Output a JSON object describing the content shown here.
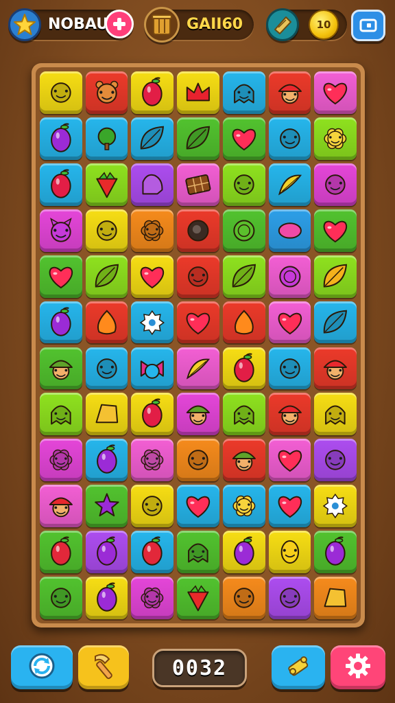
{
  "topbar": {
    "player_name": "NOBAU",
    "resource_value": "GAII60",
    "coin_value": "10",
    "icons": {
      "star": "star-icon",
      "add": "plus-icon",
      "crate": "crate-icon",
      "ticket": "ticket-icon",
      "coin": "coin-icon",
      "menu": "menu-icon"
    }
  },
  "board": {
    "columns": 7,
    "rows": 12,
    "colors": {
      "yellow": "#f7de14",
      "red": "#ec3a2a",
      "pink": "#f35fd4",
      "cyan": "#26b6ec",
      "green": "#52c32f",
      "lime": "#8fe21f",
      "purple": "#ad4df0",
      "orange": "#f68b1c",
      "magenta": "#e546d9",
      "blue": "#2d9fe8",
      "teal": "#22c7d9"
    },
    "tiles": [
      [
        {
          "bg": "yellow",
          "icon": "cookie"
        },
        {
          "bg": "red",
          "icon": "bear"
        },
        {
          "bg": "yellow",
          "icon": "berry"
        },
        {
          "bg": "yellow",
          "icon": "crown"
        },
        {
          "bg": "cyan",
          "icon": "ghost"
        },
        {
          "bg": "red",
          "icon": "mushroom-face"
        },
        {
          "bg": "pink",
          "icon": "heart"
        }
      ],
      [
        {
          "bg": "cyan",
          "icon": "plum"
        },
        {
          "bg": "cyan",
          "icon": "tree"
        },
        {
          "bg": "cyan",
          "icon": "leaf"
        },
        {
          "bg": "green",
          "icon": "leaf"
        },
        {
          "bg": "green",
          "icon": "heart"
        },
        {
          "bg": "cyan",
          "icon": "blob"
        },
        {
          "bg": "lime",
          "icon": "flower"
        }
      ],
      [
        {
          "bg": "cyan",
          "icon": "berry"
        },
        {
          "bg": "lime",
          "icon": "strawberry"
        },
        {
          "bg": "purple",
          "icon": "hand"
        },
        {
          "bg": "pink",
          "icon": "chocolate"
        },
        {
          "bg": "lime",
          "icon": "cat-face"
        },
        {
          "bg": "cyan",
          "icon": "banana"
        },
        {
          "bg": "magenta",
          "icon": "blob-face"
        }
      ],
      [
        {
          "bg": "magenta",
          "icon": "devil"
        },
        {
          "bg": "yellow",
          "icon": "blob-face"
        },
        {
          "bg": "orange",
          "icon": "flower-face"
        },
        {
          "bg": "red",
          "icon": "snail"
        },
        {
          "bg": "green",
          "icon": "coin"
        },
        {
          "bg": "blue",
          "icon": "bean"
        },
        {
          "bg": "green",
          "icon": "heart"
        }
      ],
      [
        {
          "bg": "green",
          "icon": "heart"
        },
        {
          "bg": "lime",
          "icon": "leaf"
        },
        {
          "bg": "yellow",
          "icon": "heart"
        },
        {
          "bg": "red",
          "icon": "smiley"
        },
        {
          "bg": "lime",
          "icon": "leaf"
        },
        {
          "bg": "pink",
          "icon": "ring"
        },
        {
          "bg": "lime",
          "icon": "leaf-orange"
        }
      ],
      [
        {
          "bg": "cyan",
          "icon": "plum"
        },
        {
          "bg": "red",
          "icon": "flame"
        },
        {
          "bg": "cyan",
          "icon": "gear"
        },
        {
          "bg": "red",
          "icon": "heart"
        },
        {
          "bg": "red",
          "icon": "flame"
        },
        {
          "bg": "pink",
          "icon": "heart"
        },
        {
          "bg": "cyan",
          "icon": "leaf"
        }
      ],
      [
        {
          "bg": "green",
          "icon": "acorn-face"
        },
        {
          "bg": "cyan",
          "icon": "bean-face"
        },
        {
          "bg": "cyan",
          "icon": "bow"
        },
        {
          "bg": "pink",
          "icon": "banana"
        },
        {
          "bg": "yellow",
          "icon": "berry"
        },
        {
          "bg": "cyan",
          "icon": "smiley"
        },
        {
          "bg": "red",
          "icon": "mushroom-face"
        }
      ],
      [
        {
          "bg": "lime",
          "icon": "ghost"
        },
        {
          "bg": "yellow",
          "icon": "shell"
        },
        {
          "bg": "yellow",
          "icon": "berry"
        },
        {
          "bg": "magenta",
          "icon": "acorn-face"
        },
        {
          "bg": "lime",
          "icon": "ghost"
        },
        {
          "bg": "red",
          "icon": "mushroom-face"
        },
        {
          "bg": "yellow",
          "icon": "ghost"
        }
      ],
      [
        {
          "bg": "magenta",
          "icon": "flower-face"
        },
        {
          "bg": "cyan",
          "icon": "plum"
        },
        {
          "bg": "pink",
          "icon": "flower-face"
        },
        {
          "bg": "orange",
          "icon": "cookie"
        },
        {
          "bg": "red",
          "icon": "acorn-face"
        },
        {
          "bg": "pink",
          "icon": "heart"
        },
        {
          "bg": "purple",
          "icon": "blob-face"
        }
      ],
      [
        {
          "bg": "pink",
          "icon": "mushroom-face"
        },
        {
          "bg": "green",
          "icon": "star"
        },
        {
          "bg": "yellow",
          "icon": "cookie"
        },
        {
          "bg": "cyan",
          "icon": "heart"
        },
        {
          "bg": "cyan",
          "icon": "flower"
        },
        {
          "bg": "cyan",
          "icon": "heart"
        },
        {
          "bg": "yellow",
          "icon": "gear"
        }
      ],
      [
        {
          "bg": "green",
          "icon": "pepper"
        },
        {
          "bg": "purple",
          "icon": "plum"
        },
        {
          "bg": "cyan",
          "icon": "pepper"
        },
        {
          "bg": "green",
          "icon": "ghost"
        },
        {
          "bg": "yellow",
          "icon": "plum"
        },
        {
          "bg": "yellow",
          "icon": "lemon-face"
        },
        {
          "bg": "green",
          "icon": "plum"
        }
      ],
      [
        {
          "bg": "green",
          "icon": "cookie"
        },
        {
          "bg": "yellow",
          "icon": "plum"
        },
        {
          "bg": "magenta",
          "icon": "flower-face"
        },
        {
          "bg": "green",
          "icon": "strawberry"
        },
        {
          "bg": "orange",
          "icon": "cookie"
        },
        {
          "bg": "purple",
          "icon": "blob-face"
        },
        {
          "bg": "orange",
          "icon": "shell"
        }
      ]
    ]
  },
  "bottombar": {
    "move_counter": "0032",
    "icons": {
      "refresh": "refresh-icon",
      "hammer": "hammer-icon",
      "swap": "swap-icon",
      "settings": "gear-icon"
    }
  }
}
